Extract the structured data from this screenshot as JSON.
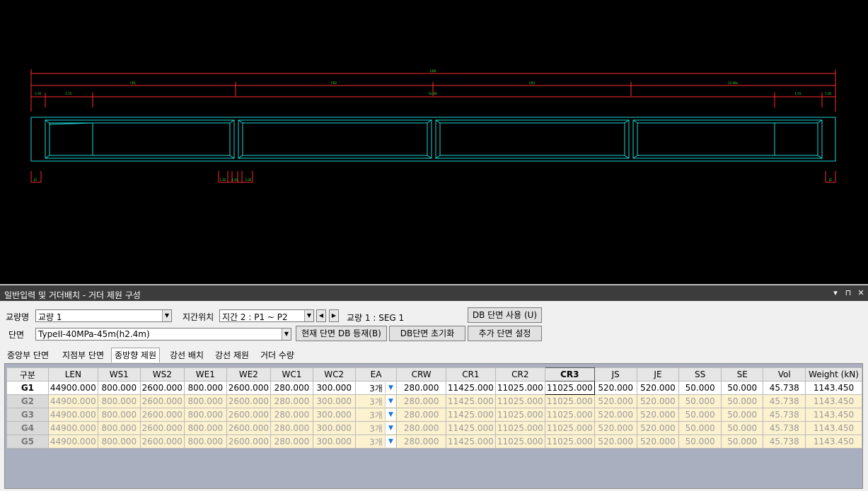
{
  "cad": {
    "colors": {
      "dim": "#ff2a2a",
      "dimtext": "#39e639",
      "outline": "#17d6d6",
      "bg": "#000000"
    },
    "segments": [
      {
        "label": "CR1"
      },
      {
        "label": "CR2"
      },
      {
        "label": "CR3"
      },
      {
        "label": "11.40a"
      }
    ],
    "overall_label": "LEN",
    "top_small": [
      "1.91",
      "1.51",
      "GL.00",
      "1.51",
      "1.91"
    ],
    "bottom_small": [
      "JS",
      "1.02",
      "1.02",
      "1.02",
      "JE"
    ]
  },
  "window": {
    "title": "일반입력 및 거더배치 - 거더 제원 구성",
    "buttons": [
      "▾",
      "⊓",
      "✕"
    ]
  },
  "form": {
    "bridge_label": "교량명",
    "bridge_value": "교량 1",
    "span_label": "지간위치",
    "span_value": "지간 2 : P1 ~ P2",
    "seg_info": "교량 1 : SEG 1",
    "db_use_button": "DB 단면 사용 (U)",
    "section_label": "단면",
    "section_value": "TypeII-40MPa-45m(h2.4m)",
    "register_button": "현재 단면 DB 등재(B)",
    "reset_button": "DB단면 초기화",
    "add_button": "추가 단면 설정"
  },
  "tabs": [
    "중앙부 단면",
    "지점부 단면",
    "종방향 제원",
    "강선 배치",
    "강선 제원",
    "거더 수량"
  ],
  "active_tab": 2,
  "grid": {
    "columns": [
      "구분",
      "LEN",
      "WS1",
      "WS2",
      "WE1",
      "WE2",
      "WC1",
      "WC2",
      "EA",
      "CRW",
      "CR1",
      "CR2",
      "CR3",
      "JS",
      "JE",
      "SS",
      "SE",
      "Vol",
      "Weight (kN)"
    ],
    "selected_column": "CR3",
    "rows": [
      {
        "name": "G1",
        "cells": [
          "44900.000",
          "800.000",
          "2600.000",
          "800.000",
          "2600.000",
          "280.000",
          "300.000",
          "3개",
          "280.000",
          "11425.000",
          "11025.000",
          "11025.000",
          "520.000",
          "520.000",
          "50.000",
          "50.000",
          "45.738",
          "1143.450"
        ]
      },
      {
        "name": "G2",
        "cells": [
          "44900.000",
          "800.000",
          "2600.000",
          "800.000",
          "2600.000",
          "280.000",
          "300.000",
          "3개",
          "280.000",
          "11425.000",
          "11025.000",
          "11025.000",
          "520.000",
          "520.000",
          "50.000",
          "50.000",
          "45.738",
          "1143.450"
        ]
      },
      {
        "name": "G3",
        "cells": [
          "44900.000",
          "800.000",
          "2600.000",
          "800.000",
          "2600.000",
          "280.000",
          "300.000",
          "3개",
          "280.000",
          "11425.000",
          "11025.000",
          "11025.000",
          "520.000",
          "520.000",
          "50.000",
          "50.000",
          "45.738",
          "1143.450"
        ]
      },
      {
        "name": "G4",
        "cells": [
          "44900.000",
          "800.000",
          "2600.000",
          "800.000",
          "2600.000",
          "280.000",
          "300.000",
          "3개",
          "280.000",
          "11425.000",
          "11025.000",
          "11025.000",
          "520.000",
          "520.000",
          "50.000",
          "50.000",
          "45.738",
          "1143.450"
        ]
      },
      {
        "name": "G5",
        "cells": [
          "44900.000",
          "800.000",
          "2600.000",
          "800.000",
          "2600.000",
          "280.000",
          "300.000",
          "3개",
          "280.000",
          "11425.000",
          "11025.000",
          "11025.000",
          "520.000",
          "520.000",
          "50.000",
          "50.000",
          "45.738",
          "1143.450"
        ]
      }
    ]
  }
}
